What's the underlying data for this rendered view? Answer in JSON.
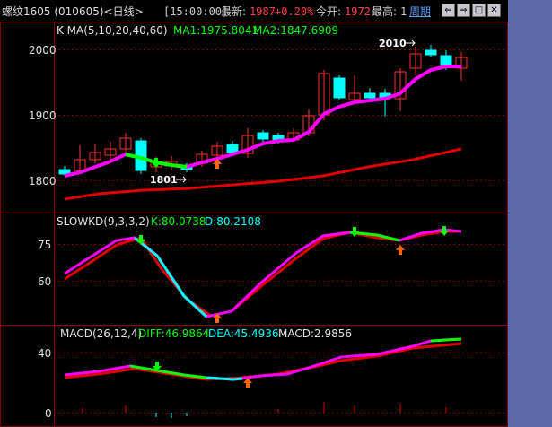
{
  "header": {
    "title": "螺纹1605 (010605)<日线>",
    "time": "[15:00:00]",
    "latest_label": "最新:",
    "latest_value": "1987",
    "change": "+0.20%",
    "open_label": "今开:",
    "open_value": "1972",
    "high_label": "最高:",
    "high_value": "1",
    "period_link": "周期"
  },
  "main_panel": {
    "indicator_label": "K  MA(5,10,20,40,60)",
    "ma1": "MA1:1975.8041",
    "ma2": "MA2:1847.6909",
    "y_ticks": [
      "2000",
      "1900",
      "1800"
    ],
    "annotation_high": "2010",
    "annotation_low": "1801"
  },
  "kd_panel": {
    "label": "SLOWKD(9,3,3,2)",
    "k": "K:80.0738",
    "d": "D:80.2108",
    "y_ticks": [
      "75",
      "60"
    ]
  },
  "macd_panel": {
    "label": "MACD(26,12,4)",
    "diff": "DIFF:46.9864",
    "dea": "DEA:45.4936",
    "macd": "MACD:2.9856",
    "y_ticks": [
      "40",
      "0"
    ]
  },
  "colors": {
    "up": "#ff4040",
    "down": "#00ffff",
    "ma_main": "#ff00ff",
    "ma_slow": "#e00000",
    "green": "#00ff00",
    "grid": "#800000",
    "yellow": "#ffff00"
  },
  "nav_buttons": [
    "⇐",
    "⇒",
    "□",
    "✕"
  ]
}
